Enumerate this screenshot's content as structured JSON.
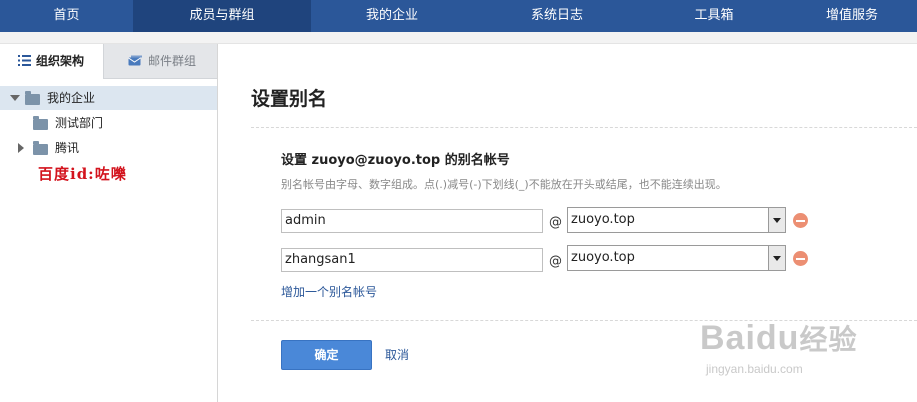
{
  "nav": {
    "items": [
      {
        "label": "首页"
      },
      {
        "label": "成员与群组"
      },
      {
        "label": "我的企业"
      },
      {
        "label": "系统日志"
      },
      {
        "label": "工具箱"
      },
      {
        "label": "增值服务"
      }
    ],
    "active_index": 1
  },
  "sidebar": {
    "tabs": [
      {
        "label": "组织架构",
        "icon": "list-icon"
      },
      {
        "label": "邮件群组",
        "icon": "mail-group-icon"
      }
    ],
    "tree": [
      {
        "label": "我的企业",
        "expanded": true
      },
      {
        "label": "测试部门"
      },
      {
        "label": "腾讯",
        "expanded": false
      }
    ],
    "annotation": "百度id:咗嚛"
  },
  "main": {
    "title": "设置别名",
    "section_title": "设置 zuoyo@zuoyo.top 的别名帐号",
    "hint": "别名帐号由字母、数字组成。点(.)减号(-)下划线(_)不能放在开头或结尾，也不能连续出现。",
    "aliases": [
      {
        "value": "admin",
        "at": "@",
        "domain": "zuoyo.top"
      },
      {
        "value": "zhangsan1",
        "at": "@",
        "domain": "zuoyo.top"
      }
    ],
    "add_link": "增加一个别名帐号",
    "confirm": "确定",
    "cancel": "取消"
  },
  "watermark": {
    "logo": "Baidu",
    "logo_cn": "经验",
    "url": "jingyan.baidu.com"
  },
  "colors": {
    "nav_bg": "#2b5799",
    "nav_active": "#1f447d",
    "primary_button": "#4a88d8",
    "remove_icon": "#ec8f73",
    "annotation_red": "#d3131d"
  }
}
